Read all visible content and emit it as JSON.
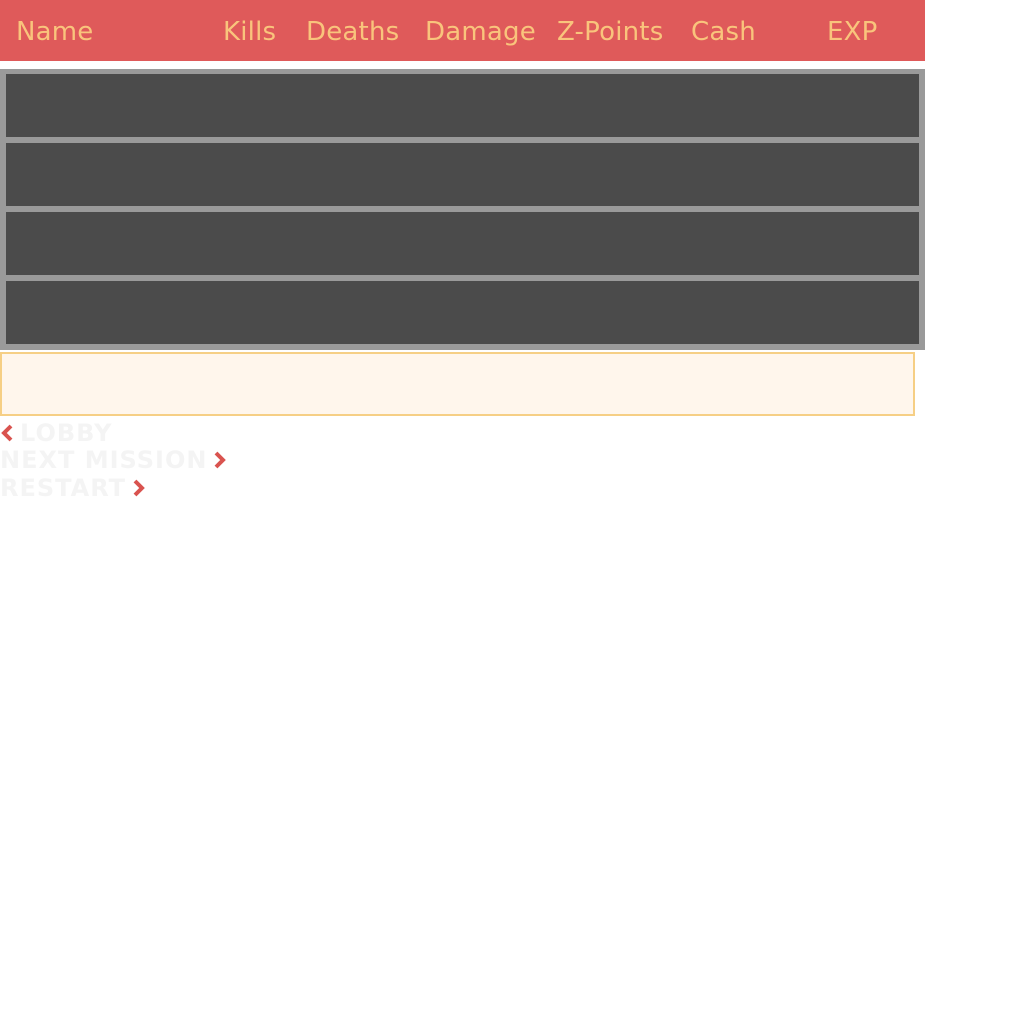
{
  "scoreboard": {
    "columns": [
      "Name",
      "Kills",
      "Deaths",
      "Damage",
      "Z-Points",
      "Cash",
      "EXP"
    ],
    "rows": [
      {
        "name": "",
        "kills": "",
        "deaths": "",
        "damage": "",
        "zpoints": "",
        "cash": "",
        "exp": ""
      },
      {
        "name": "",
        "kills": "",
        "deaths": "",
        "damage": "",
        "zpoints": "",
        "cash": "",
        "exp": ""
      },
      {
        "name": "",
        "kills": "",
        "deaths": "",
        "damage": "",
        "zpoints": "",
        "cash": "",
        "exp": ""
      },
      {
        "name": "",
        "kills": "",
        "deaths": "",
        "damage": "",
        "zpoints": "",
        "cash": "",
        "exp": ""
      }
    ]
  },
  "notice": {
    "text": ""
  },
  "menu": {
    "back_label": "LOBBY",
    "next_mission_label": "NEXT MISSION",
    "restart_label": "RESTART"
  },
  "colors": {
    "header_bg": "#df5a5a",
    "header_text": "#f9c47c",
    "row_bg": "#4b4b4b",
    "rows_frame": "#9a9a9a",
    "notice_bg": "#fff6ec",
    "notice_border": "#f6cf85",
    "chevron": "#d9534f",
    "menu_text": "#f4f4f4"
  }
}
